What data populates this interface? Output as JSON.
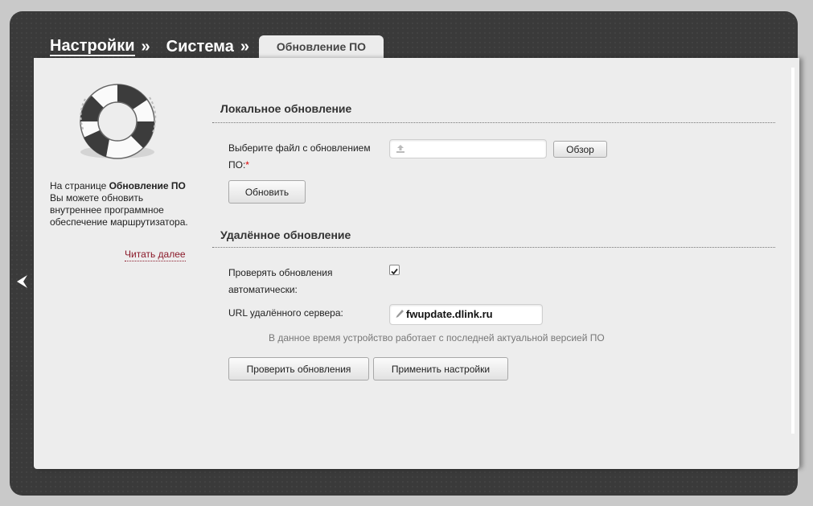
{
  "breadcrumb": {
    "items": [
      {
        "label": "Настройки",
        "sep": "»"
      },
      {
        "label": "Система",
        "sep": "»"
      }
    ],
    "active_tab": "Обновление ПО"
  },
  "sidebar": {
    "help_prefix": "На странице ",
    "help_bold": "Обновление ПО",
    "help_suffix": " Вы можете обновить внутреннее программное обеспечение маршрутизатора.",
    "read_more": "Читать далее",
    "icon": "lifebuoy-icon"
  },
  "local_update": {
    "title": "Локальное обновление",
    "file_label": "Выберите файл с обновлением ПО:",
    "required_mark": "*",
    "file_value": "",
    "browse_label": "Обзор",
    "update_label": "Обновить"
  },
  "remote_update": {
    "title": "Удалённое обновление",
    "auto_check_label": "Проверять обновления автоматически:",
    "auto_check_checked": true,
    "url_label": "URL удалённого сервера:",
    "url_value": "fwupdate.dlink.ru",
    "status_text": "В данное время устройство работает с последней актуальной версией ПО",
    "check_label": "Проверить обновления",
    "apply_label": "Применить настройки"
  },
  "colors": {
    "frame": "#3a3a3a",
    "panel": "#ededed",
    "link": "#8b1a2a",
    "required": "#dd0000"
  }
}
